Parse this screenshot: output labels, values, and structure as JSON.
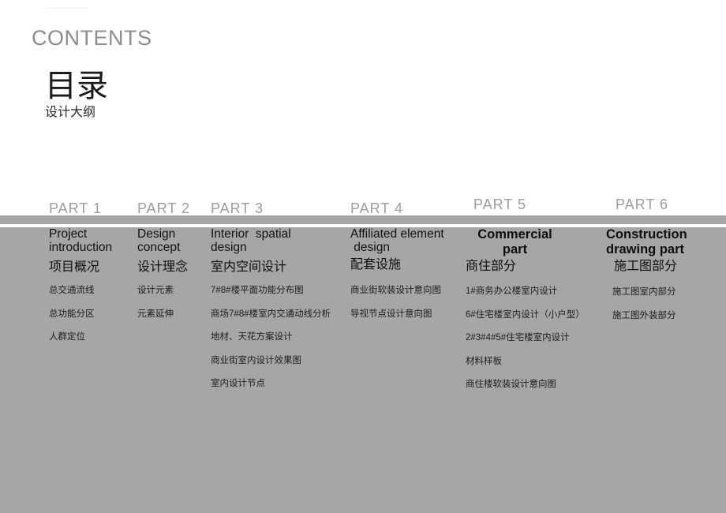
{
  "slide": {
    "title_en": "CONTENTS",
    "title_cn": "目录",
    "subtitle_cn": "设计大纲",
    "accent_gray": "#a6a6a6",
    "label_gray": "#9d9d9d",
    "title_gray": "#8d8d8d"
  },
  "parts": [
    {
      "label": "PART 1",
      "title_en": "Project\nintroduction",
      "title_cn": "项目概况",
      "items": [
        "总交通流线",
        "总功能分区",
        "人群定位"
      ]
    },
    {
      "label": "PART 2",
      "title_en": "Design\nconcept",
      "title_cn": "设计理念",
      "items": [
        "设计元素",
        "元素延伸"
      ]
    },
    {
      "label": "PART 3",
      "title_en": "Interior  spatial\ndesign",
      "title_cn": "室内空间设计",
      "items": [
        "7#8#楼平面功能分布图",
        "商场7#8#楼室内交通动线分析",
        "地材、天花方案设计",
        "商业街室内设计效果图",
        "室内设计节点"
      ]
    },
    {
      "label": "PART 4",
      "title_en": "Affiliated element\n design",
      "title_cn": "配套设施",
      "items": [
        "商业街软装设计意向图",
        "导视节点设计意向图"
      ]
    },
    {
      "label": "PART 5",
      "title_en": "Commercial\npart",
      "title_cn": "商住部分",
      "items": [
        "1#商务办公楼室内设计",
        "6#住宅楼室内设计（小户型）",
        "2#3#4#5#住宅楼室内设计",
        "材料样板",
        "商住楼软装设计意向图"
      ]
    },
    {
      "label": "PART 6",
      "title_en": "Construction\ndrawing part",
      "title_cn": "施工图部分",
      "items": [
        "施工图室内部分",
        "施工图外装部分"
      ]
    }
  ]
}
